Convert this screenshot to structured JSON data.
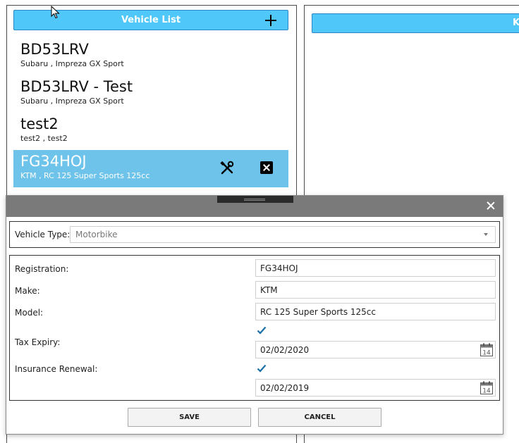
{
  "vehicle_list": {
    "title": "Vehicle List",
    "add_icon": "plus-icon",
    "items": [
      {
        "registration": "BD53LRV",
        "details": "Subaru ,  Impreza GX Sport",
        "selected": false
      },
      {
        "registration": "BD53LRV - Test",
        "details": "Subaru ,  Impreza GX Sport",
        "selected": false
      },
      {
        "registration": "test2",
        "details": "test2 ,  test2",
        "selected": false
      },
      {
        "registration": "FG34HOJ",
        "details": "KTM ,  RC 125 Super Sports 125cc",
        "selected": true,
        "tools_icon": "wrench-screwdriver-icon",
        "delete_icon": "delete-box-icon"
      }
    ]
  },
  "right_panel": {
    "title": "K"
  },
  "dialog": {
    "close_icon": "close-icon",
    "vehicle_type": {
      "label": "Vehicle Type:",
      "value": "Motorbike"
    },
    "fields": {
      "registration": {
        "label": "Registration:",
        "value": "FG34HOJ"
      },
      "make": {
        "label": "Make:",
        "value": "KTM"
      },
      "model": {
        "label": "Model:",
        "value": "RC 125 Super Sports 125cc"
      },
      "tax_expiry": {
        "label": "Tax Expiry:",
        "checked": true,
        "date": "02/02/2020",
        "calendar_day": "14"
      },
      "insurance_renewal": {
        "label": "Insurance Renewal:",
        "checked": true,
        "date": "02/02/2019",
        "calendar_day": "14"
      }
    },
    "save_label": "SAVE",
    "cancel_label": "CANCEL"
  },
  "colors": {
    "header_blue": "#4fc7f8",
    "selected_blue": "#6ec3ea",
    "titlebar_gray": "#7a7a7a",
    "check_blue": "#1a6fa8"
  }
}
